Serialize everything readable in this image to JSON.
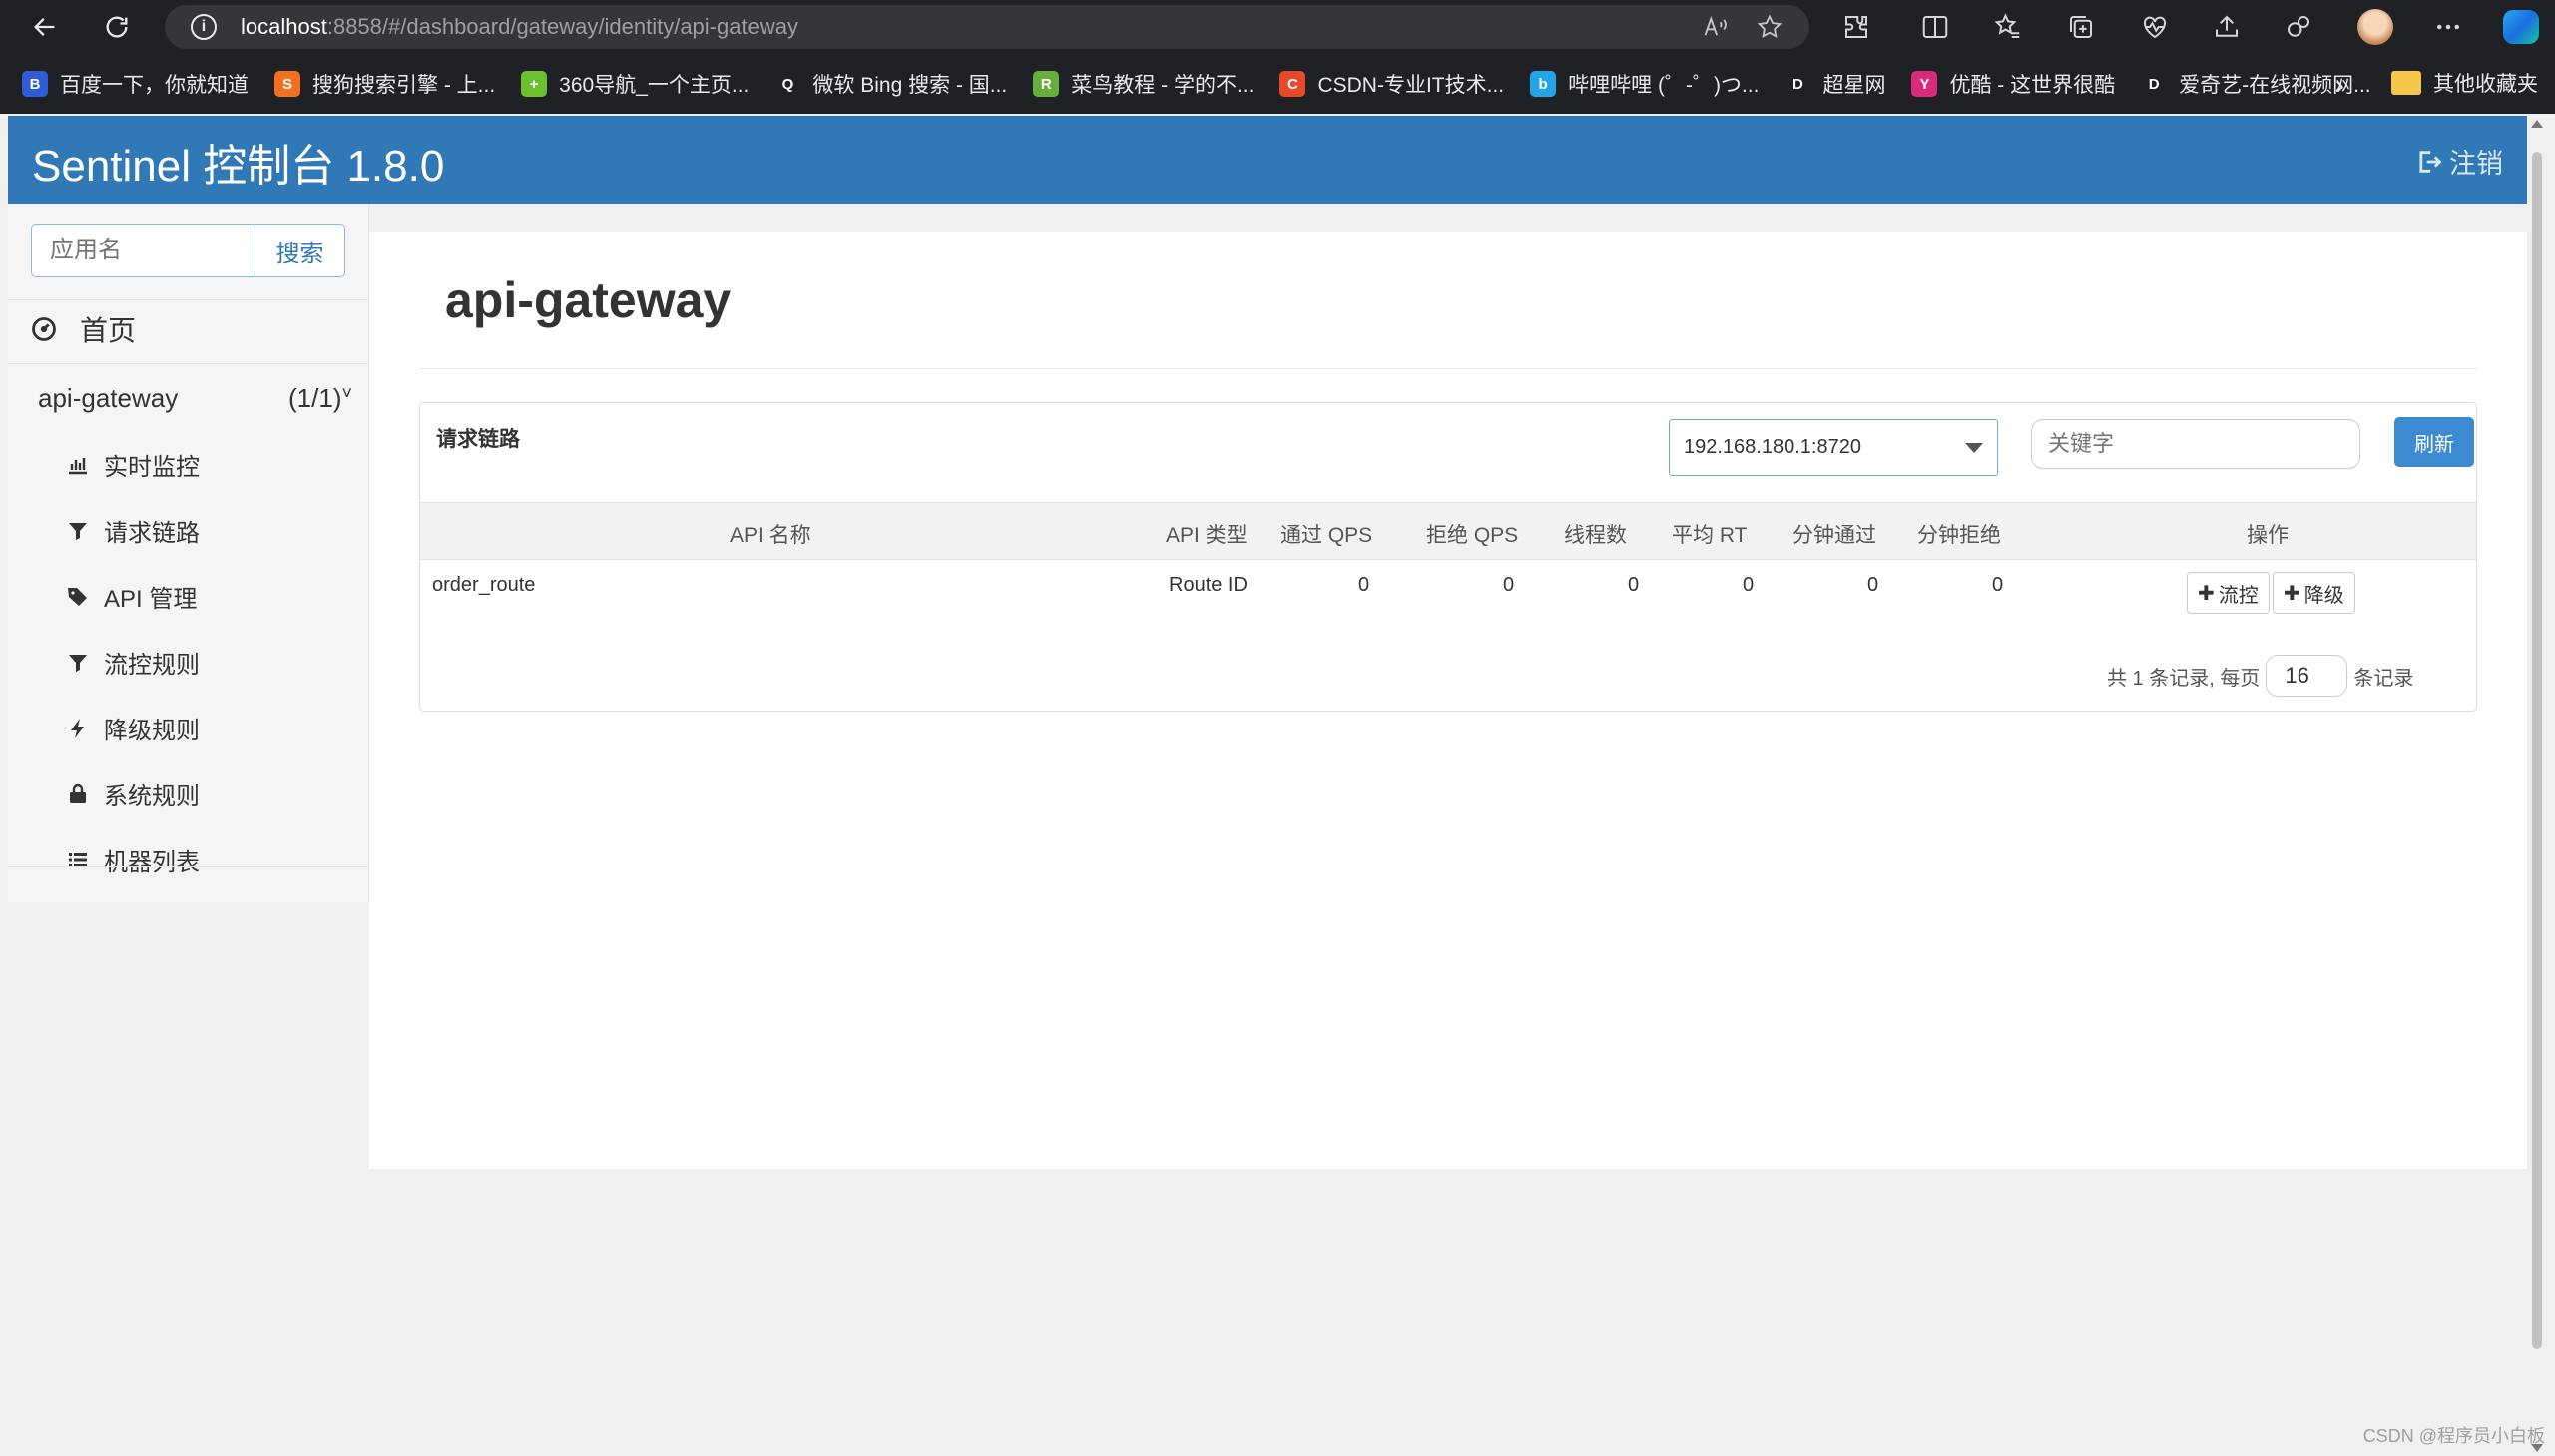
{
  "browser": {
    "url_host": "localhost",
    "url_rest": ":8858/#/dashboard/gateway/identity/api-gateway",
    "bookmarks": [
      {
        "label": "百度一下，你就知道",
        "color": "#2e5bd8",
        "glyph": "B"
      },
      {
        "label": "搜狗搜索引擎 - 上...",
        "color": "#f36f21",
        "glyph": "S"
      },
      {
        "label": "360导航_一个主页...",
        "color": "#6cbf2e",
        "glyph": "+"
      },
      {
        "label": "微软 Bing 搜索 - 国...",
        "color": "#202124",
        "glyph": "Q"
      },
      {
        "label": "菜鸟教程 - 学的不...",
        "color": "#6aaf3d",
        "glyph": "R"
      },
      {
        "label": "CSDN-专业IT技术...",
        "color": "#e8492a",
        "glyph": "C"
      },
      {
        "label": "哔哩哔哩 (゜-゜)つ...",
        "color": "#22a6e8",
        "glyph": "b"
      },
      {
        "label": "超星网",
        "color": "#202124",
        "glyph": "D"
      },
      {
        "label": "优酷 - 这世界很酷",
        "color": "#d92a7c",
        "glyph": "Y"
      },
      {
        "label": "爱奇艺-在线视频网...",
        "color": "#202124",
        "glyph": "D"
      }
    ],
    "other_bookmarks": "其他收藏夹"
  },
  "header": {
    "title": "Sentinel 控制台 1.8.0",
    "logout": "注销"
  },
  "sidebar": {
    "search_placeholder": "应用名",
    "search_button": "搜索",
    "home": "首页",
    "app_name": "api-gateway",
    "app_count": "(1/1)",
    "items": [
      {
        "label": "实时监控",
        "icon": "bar-chart-icon"
      },
      {
        "label": "请求链路",
        "icon": "filter-icon"
      },
      {
        "label": "API 管理",
        "icon": "tags-icon"
      },
      {
        "label": "流控规则",
        "icon": "filter-icon"
      },
      {
        "label": "降级规则",
        "icon": "flash-icon"
      },
      {
        "label": "系统规则",
        "icon": "lock-icon"
      },
      {
        "label": "机器列表",
        "icon": "list-icon"
      }
    ]
  },
  "main": {
    "title": "api-gateway",
    "panel_title": "请求链路",
    "machine_select": "192.168.180.1:8720",
    "keyword_placeholder": "关键字",
    "refresh": "刷新",
    "columns": [
      "API 名称",
      "API 类型",
      "通过 QPS",
      "拒绝 QPS",
      "线程数",
      "平均 RT",
      "分钟通过",
      "分钟拒绝",
      "操作"
    ],
    "rows": [
      {
        "name": "order_route",
        "type": "Route ID",
        "pass_qps": "0",
        "block_qps": "0",
        "threads": "0",
        "avg_rt": "0",
        "minute_pass": "0",
        "minute_block": "0",
        "actions": [
          "流控",
          "降级"
        ]
      }
    ],
    "pager_prefix": "共 1 条记录, 每页",
    "page_size": "16",
    "pager_suffix": "条记录"
  },
  "watermark": "CSDN @程序员小白板"
}
